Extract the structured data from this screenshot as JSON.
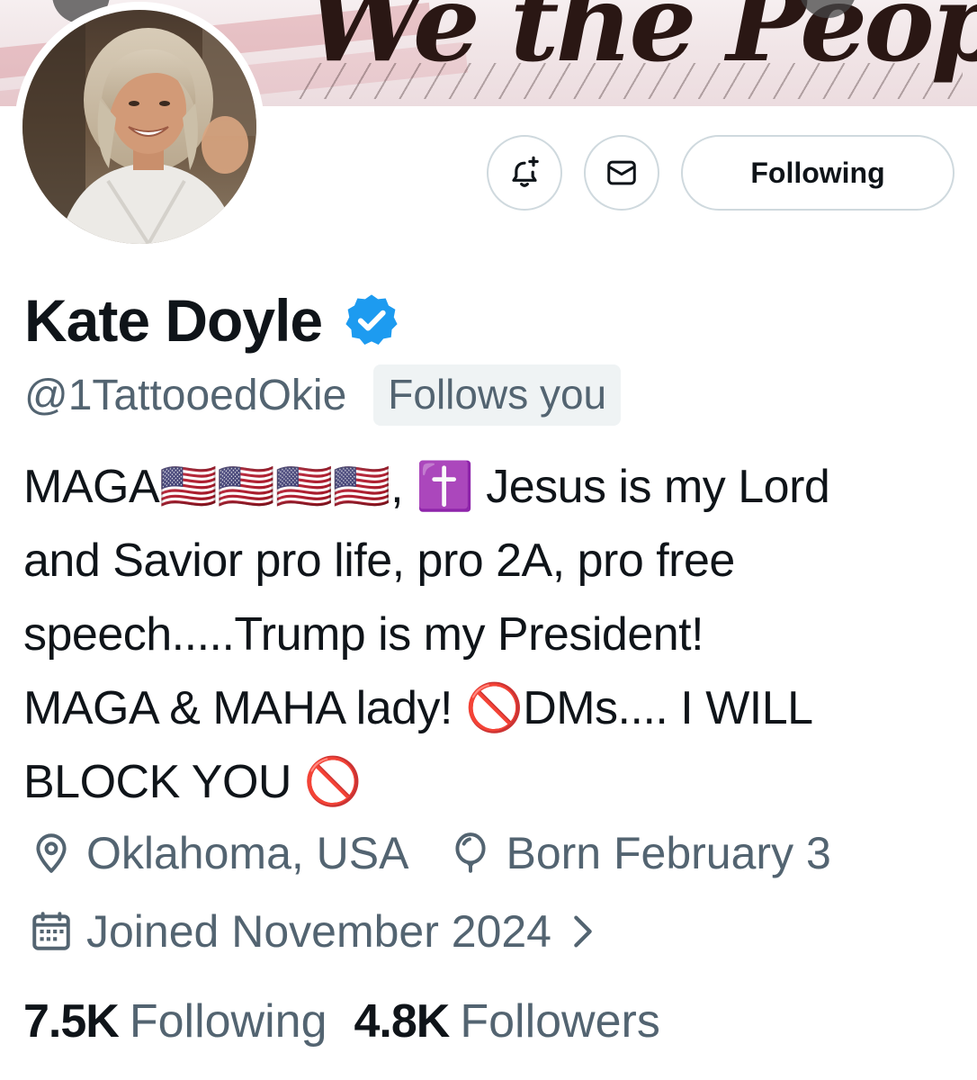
{
  "banner": {
    "text": "We the People"
  },
  "actions": {
    "following_label": "Following"
  },
  "profile": {
    "display_name": "Kate Doyle",
    "handle": "@1TattooedOkie",
    "follows_you": "Follows you",
    "bio_lines": [
      "MAGA🇺🇸🇺🇸🇺🇸🇺🇸, ✝️ Jesus is my Lord",
      "and Savior pro life, pro 2A, pro free",
      "speech.....Trump is my President!",
      "MAGA & MAHA lady! 🚫DMs.... I WILL",
      "BLOCK YOU 🚫"
    ],
    "location": "Oklahoma, USA",
    "birthday": "Born February 3",
    "joined": "Joined November 2024"
  },
  "stats": {
    "following_count": "7.5K",
    "following_label": "Following",
    "followers_count": "4.8K",
    "followers_label": "Followers"
  },
  "colors": {
    "text_primary": "#0f1419",
    "text_secondary": "#536471",
    "verified_blue": "#1d9bf0",
    "border": "#cfd9de",
    "badge_bg": "#eff3f4"
  },
  "icons": {
    "notify": "bell-plus-icon",
    "message": "envelope-icon",
    "verified": "verified-badge-icon",
    "location": "location-pin-icon",
    "birthday": "balloon-icon",
    "joined": "calendar-icon",
    "expand": "chevron-right-icon"
  }
}
